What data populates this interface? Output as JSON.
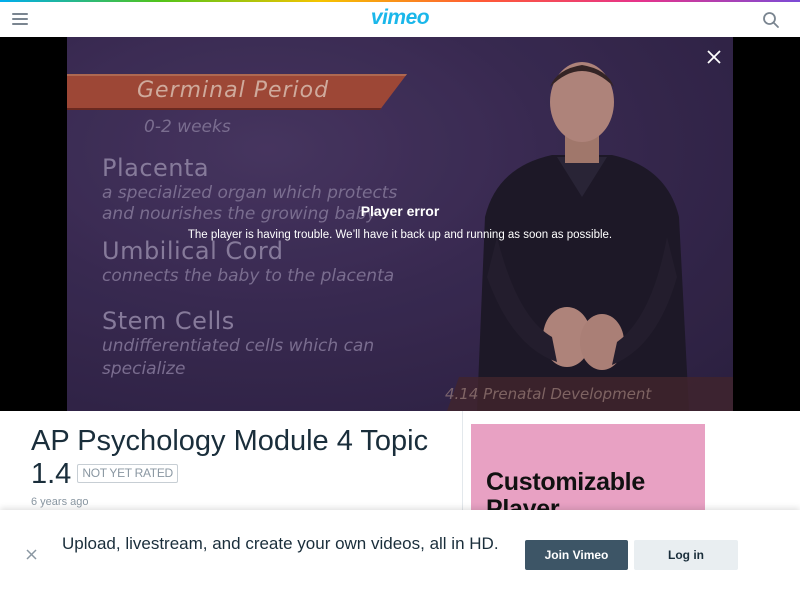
{
  "header": {
    "logo_text": "vimeo",
    "menu_icon": "hamburger-menu-icon",
    "search_icon": "search-icon",
    "accent_color": "#1ab7ea"
  },
  "player": {
    "error_title": "Player error",
    "error_message": "The player is having trouble. We’ll have it back up and running as soon as possible.",
    "close_icon": "close-icon",
    "frame": {
      "section_title": "Germinal Period",
      "section_subtitle": "0-2 weeks",
      "term_1": "Placenta",
      "term_1_def_1": "a specialized organ which protects",
      "term_1_def_2": "and nourishes the growing baby",
      "term_2": "Umbilical Cord",
      "term_2_def": "connects the baby to the placenta",
      "term_3": "Stem Cells",
      "term_3_def_1": "undifferentiated cells which can",
      "term_3_def_2": "specialize",
      "footer_caption": "4.14 Prenatal Development"
    }
  },
  "video_info": {
    "title": "AP Psychology Module 4 Topic 1.4",
    "rating_badge": "NOT YET RATED",
    "posted": "6 years ago"
  },
  "ad": {
    "text": "Customizable Player",
    "bg_color": "#e8a1c3"
  },
  "signup_banner": {
    "message": "Upload, livestream, and create your own videos, all in HD.",
    "join_label": "Join Vimeo",
    "login_label": "Log in",
    "close_icon": "close-icon"
  }
}
